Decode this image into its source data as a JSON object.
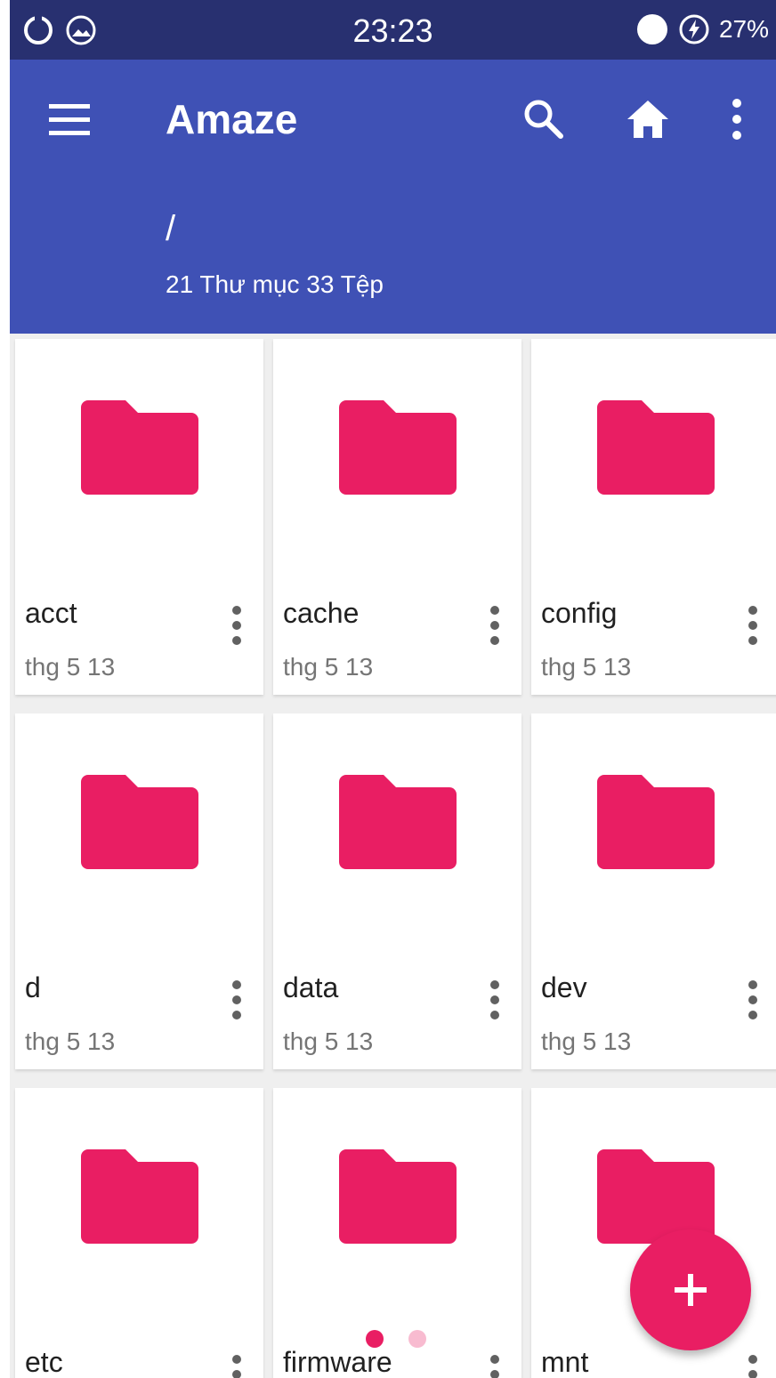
{
  "status_bar": {
    "time": "23:23",
    "battery": "27%"
  },
  "app_bar": {
    "title": "Amaze",
    "path": "/",
    "summary": "21 Thư mục 33 Tệp"
  },
  "icons": {
    "menu": "hamburger-menu-icon",
    "search": "search-icon",
    "home": "home-icon",
    "overflow": "more-vert-icon",
    "folder": "folder-icon",
    "fab": "plus-icon"
  },
  "colors": {
    "status_bar": "#283070",
    "app_bar": "#3f51b5",
    "accent": "#e91e63"
  },
  "folders": [
    {
      "name": "acct",
      "date": "thg 5 13"
    },
    {
      "name": "cache",
      "date": "thg 5 13"
    },
    {
      "name": "config",
      "date": "thg 5 13"
    },
    {
      "name": "d",
      "date": "thg 5 13"
    },
    {
      "name": "data",
      "date": "thg 5 13"
    },
    {
      "name": "dev",
      "date": "thg 5 13"
    },
    {
      "name": "etc",
      "date": ""
    },
    {
      "name": "firmware",
      "date": ""
    },
    {
      "name": "mnt",
      "date": ""
    }
  ]
}
